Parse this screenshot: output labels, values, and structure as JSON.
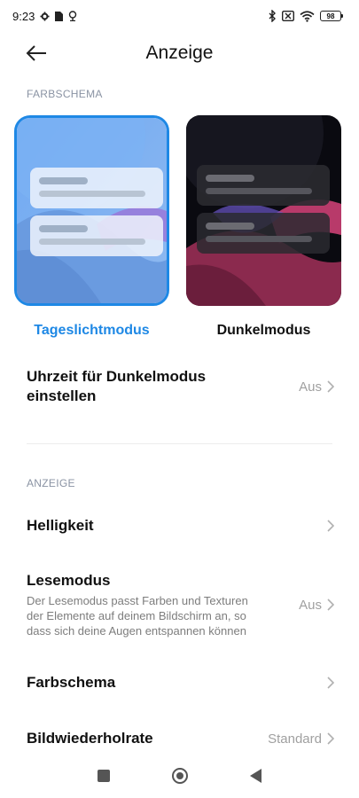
{
  "status_bar": {
    "time": "9:23",
    "battery": "98",
    "icons_left": [
      "gear-icon",
      "sim-icon",
      "location-icon"
    ],
    "icons_right": [
      "bluetooth-icon",
      "no-sim-icon",
      "wifi-icon",
      "battery-icon"
    ]
  },
  "header": {
    "title": "Anzeige",
    "back_icon": "arrow-left-icon"
  },
  "color_scheme_section": {
    "label": "FARBSCHEMA",
    "options": [
      {
        "label": "Tageslichtmodus",
        "selected": true,
        "accent": "#1e88e5"
      },
      {
        "label": "Dunkelmodus",
        "selected": false
      }
    ]
  },
  "dark_schedule": {
    "title_line1": "Uhrzeit für Dunkelmodus",
    "title_line2": "einstellen",
    "value": "Aus"
  },
  "display_section": {
    "label": "ANZEIGE"
  },
  "brightness": {
    "title": "Helligkeit"
  },
  "reading_mode": {
    "title": "Lesemodus",
    "desc_line1": "Der Lesemodus passt Farben und Texturen",
    "desc_line2": "der Elemente auf deinem Bildschirm an, so",
    "desc_line3": "dass sich deine Augen entspannen können",
    "value": "Aus"
  },
  "color_scheme_item": {
    "title": "Farbschema"
  },
  "refresh_rate": {
    "title": "Bildwiederholrate",
    "value": "Standard"
  },
  "nav": {
    "icons": [
      "recents-icon",
      "home-icon",
      "back-icon"
    ]
  }
}
